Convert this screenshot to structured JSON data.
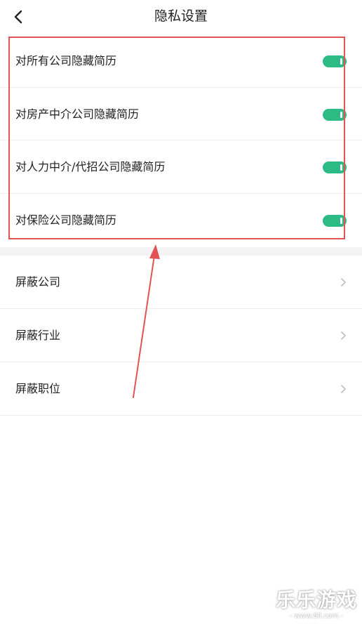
{
  "header": {
    "title": "隐私设置",
    "back_icon": "chevron-left-icon"
  },
  "privacy_toggles": [
    {
      "label": "对所有公司隐藏简历",
      "enabled": true
    },
    {
      "label": "对房产中介公司隐藏简历",
      "enabled": true
    },
    {
      "label": "对人力中介/代招公司隐藏简历",
      "enabled": true
    },
    {
      "label": "对保险公司隐藏简历",
      "enabled": true
    }
  ],
  "block_items": [
    {
      "label": "屏蔽公司",
      "icon": "chevron-right-icon"
    },
    {
      "label": "屏蔽行业",
      "icon": "chevron-right-icon"
    },
    {
      "label": "屏蔽职位",
      "icon": "chevron-right-icon"
    }
  ],
  "colors": {
    "toggle_on": "#2cba85",
    "highlight": "#e25353",
    "divider": "#efefef",
    "section_gap": "#f4f4f4"
  },
  "watermark": {
    "logo": "乐乐游戏",
    "url": "- www.6ll.com -"
  }
}
